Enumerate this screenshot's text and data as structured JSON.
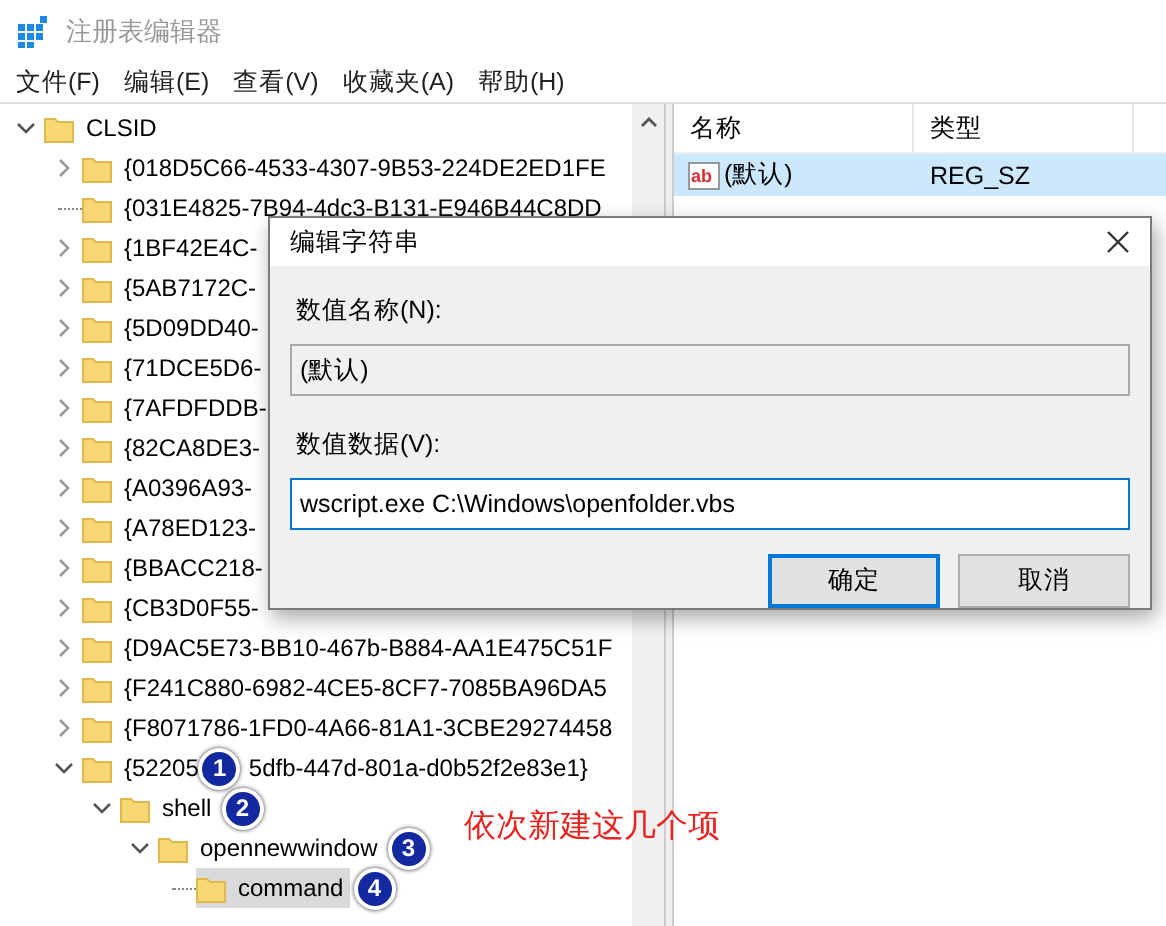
{
  "window": {
    "title": "注册表编辑器"
  },
  "menu": [
    "文件(F)",
    "编辑(E)",
    "查看(V)",
    "收藏夹(A)",
    "帮助(H)"
  ],
  "tree": [
    {
      "name": "CLSID",
      "kind": "branch",
      "expanded": true,
      "selected": false,
      "children": [
        {
          "name": "{018D5C66-4533-4307-9B53-224DE2ED1FE",
          "kind": "branch",
          "expanded": false,
          "selected": false
        },
        {
          "name": "{031E4825-7B94-4dc3-B131-E946B44C8DD",
          "kind": "leaf",
          "selected": false
        },
        {
          "name": "{1BF42E4C-",
          "kind": "branch",
          "expanded": false,
          "selected": false
        },
        {
          "name": "{5AB7172C-",
          "kind": "branch",
          "expanded": false,
          "selected": false
        },
        {
          "name": "{5D09DD40-",
          "kind": "branch",
          "expanded": false,
          "selected": false
        },
        {
          "name": "{71DCE5D6-",
          "kind": "branch",
          "expanded": false,
          "selected": false
        },
        {
          "name": "{7AFDFDDB-",
          "kind": "branch",
          "expanded": false,
          "selected": false
        },
        {
          "name": "{82CA8DE3-",
          "kind": "branch",
          "expanded": false,
          "selected": false
        },
        {
          "name": "{A0396A93-",
          "kind": "branch",
          "expanded": false,
          "selected": false
        },
        {
          "name": "{A78ED123-",
          "kind": "branch",
          "expanded": false,
          "selected": false
        },
        {
          "name": "{BBACC218-",
          "kind": "branch",
          "expanded": false,
          "selected": false
        },
        {
          "name": "{CB3D0F55-",
          "kind": "branch",
          "expanded": false,
          "selected": false
        },
        {
          "name": "{D9AC5E73-BB10-467b-B884-AA1E475C51F",
          "kind": "branch",
          "expanded": false,
          "selected": false
        },
        {
          "name": "{F241C880-6982-4CE5-8CF7-7085BA96DA5",
          "kind": "branch",
          "expanded": false,
          "selected": false
        },
        {
          "name": "{F8071786-1FD0-4A66-81A1-3CBE29274458",
          "kind": "branch",
          "expanded": false,
          "selected": false
        },
        {
          "name": "{52205",
          "badge": "1",
          "name_after_badge": "5dfb-447d-801a-d0b52f2e83e1}",
          "kind": "branch",
          "expanded": true,
          "selected": false,
          "children": [
            {
              "name": "shell",
              "badge": "2",
              "kind": "branch",
              "expanded": true,
              "selected": false,
              "children": [
                {
                  "name": "opennewwindow",
                  "badge": "3",
                  "kind": "branch",
                  "expanded": true,
                  "selected": false,
                  "children": [
                    {
                      "name": "command",
                      "badge": "4",
                      "kind": "leaf",
                      "selected": true
                    }
                  ]
                }
              ]
            }
          ]
        }
      ]
    }
  ],
  "values": {
    "columns": [
      "名称",
      "类型"
    ],
    "rows": [
      {
        "icon_text": "ab",
        "name": "(默认)",
        "type": "REG_SZ",
        "selected": true
      }
    ]
  },
  "dialog": {
    "title": "编辑字符串",
    "name_label": "数值名称(N):",
    "name_value": "(默认)",
    "data_label": "数值数据(V):",
    "data_value": "wscript.exe C:\\Windows\\openfolder.vbs",
    "buttons": [
      {
        "label": "确定",
        "default": true
      },
      {
        "label": "取消",
        "default": false
      }
    ]
  },
  "annotation": {
    "text": "依次新建这几个项"
  }
}
